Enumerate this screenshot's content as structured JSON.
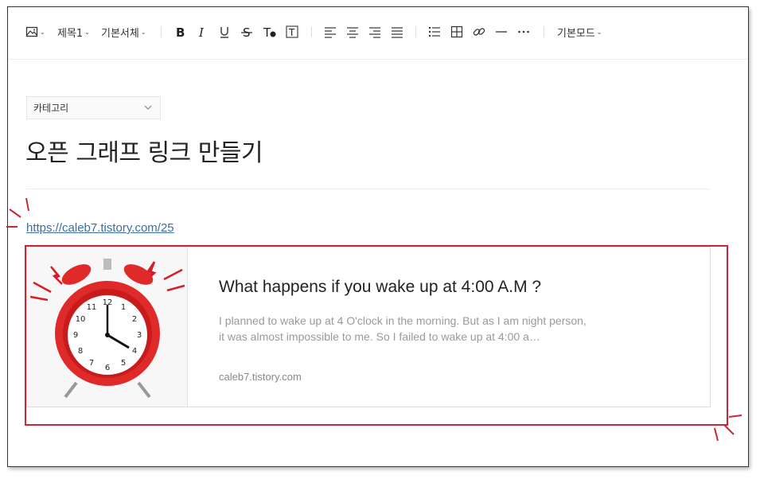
{
  "toolbar": {
    "heading_label": "제목1",
    "font_label": "기본서체",
    "mode_label": "기본모드",
    "icons": [
      "image-icon",
      "bold-icon",
      "italic-icon",
      "underline-icon",
      "strikethrough-icon",
      "text-color-icon",
      "text-background-icon",
      "align-left-icon",
      "align-center-icon",
      "align-right-icon",
      "align-justify-icon",
      "bullet-list-icon",
      "table-icon",
      "link-icon",
      "horizontal-line-icon",
      "more-icon"
    ]
  },
  "editor": {
    "category_label": "카테고리",
    "post_title": "오픈 그래프 링크 만들기",
    "link_text": "https://caleb7.tistory.com/25"
  },
  "og_card": {
    "title": "What happens if you wake up at 4:00 A.M ?",
    "description": "I planned to wake up at 4 O'clock in the morning. But as I am night person, it was almost impossible to me. So I failed to wake up at 4:00 a…",
    "domain": "caleb7.tistory.com"
  },
  "colors": {
    "highlight": "#c8273a",
    "link": "#3a6ea5",
    "clock_red": "#e02a2a"
  }
}
